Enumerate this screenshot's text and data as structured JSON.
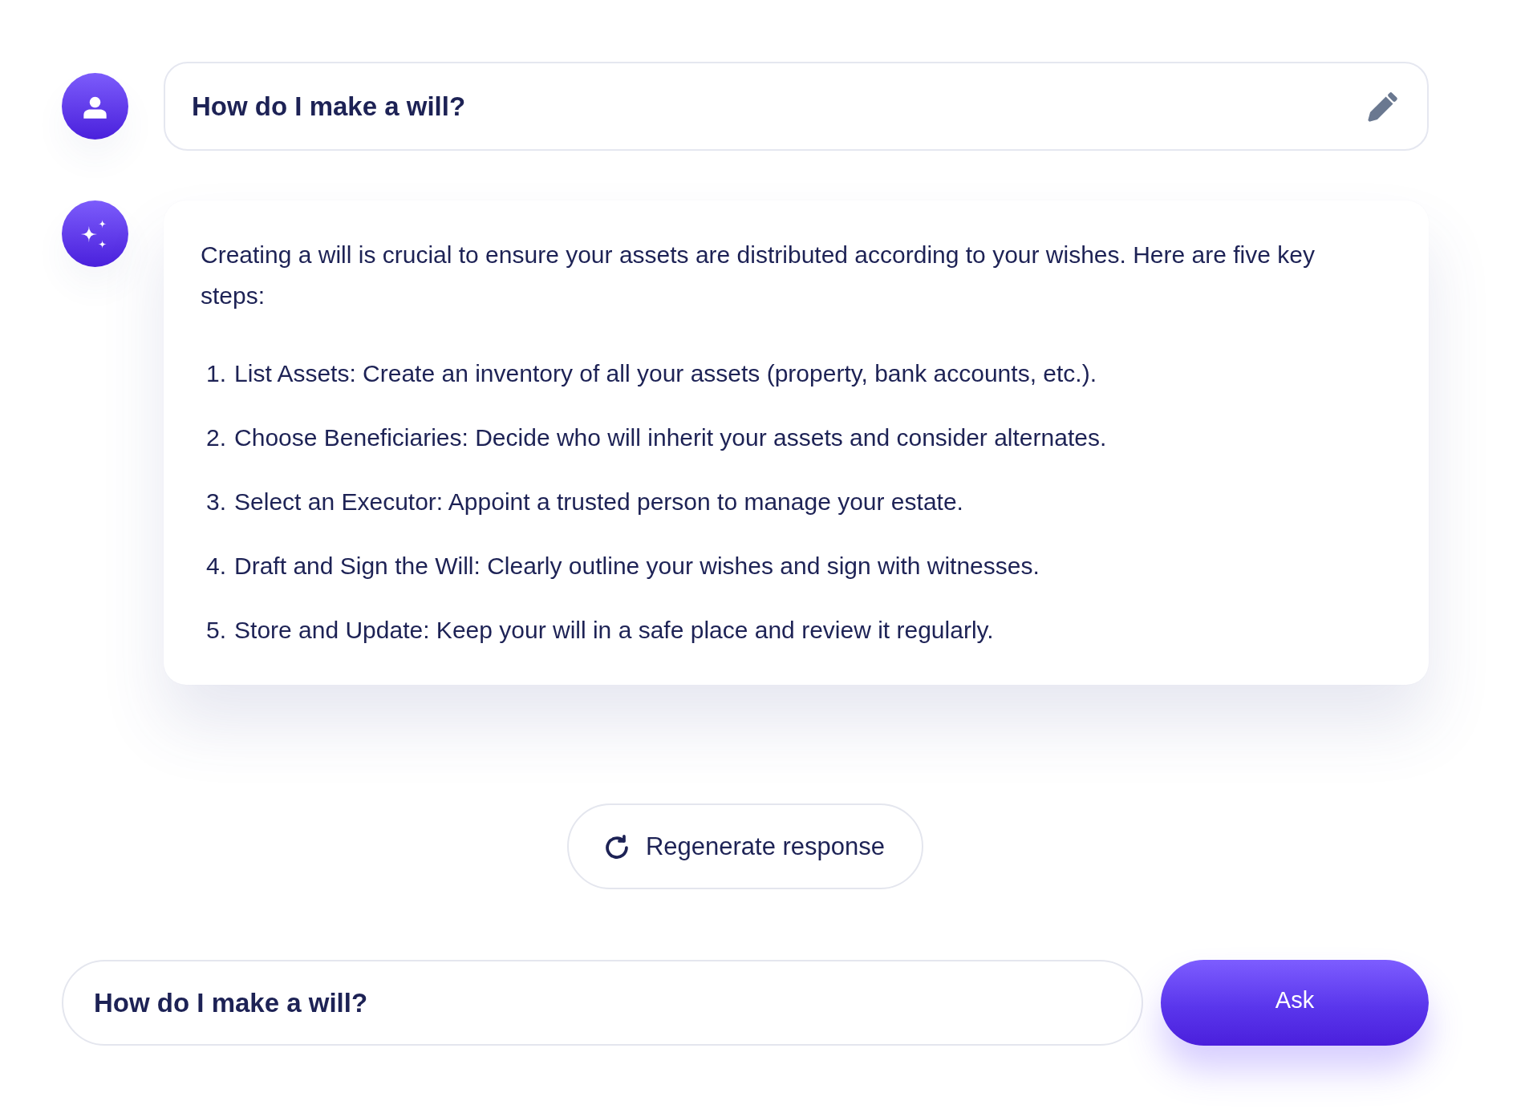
{
  "conversation": {
    "user_message": {
      "text": "How do I make a will?"
    },
    "assistant_message": {
      "intro": "Creating a will is crucial to ensure your assets are distributed according to your wishes. Here are five key steps:",
      "steps": [
        {
          "number": "1.",
          "text": "List Assets: Create an inventory of all your assets (property, bank accounts, etc.)."
        },
        {
          "number": "2.",
          "text": "Choose Beneficiaries: Decide who will inherit your assets and consider alternates."
        },
        {
          "number": "3.",
          "text": "Select an Executor: Appoint a trusted person to manage your estate."
        },
        {
          "number": "4.",
          "text": "Draft and Sign the Will: Clearly outline your wishes and sign with witnesses."
        },
        {
          "number": "5.",
          "text": "Store and Update: Keep your will in a safe place and review it regularly."
        }
      ]
    }
  },
  "regenerate_button": {
    "label": "Regenerate response"
  },
  "composer": {
    "value": "How do I make a will?",
    "button": "Ask"
  }
}
